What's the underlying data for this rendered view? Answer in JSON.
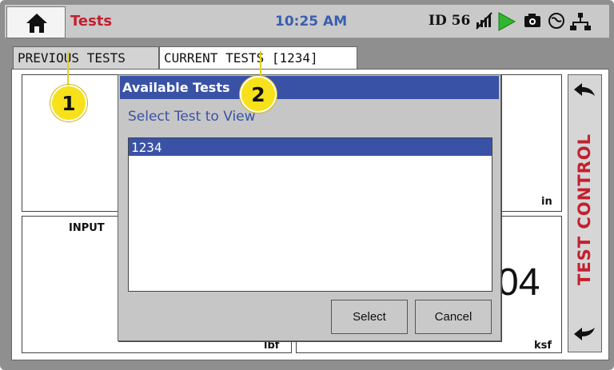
{
  "topbar": {
    "home_icon": "home-icon",
    "title": "Tests",
    "time": "10:25 AM",
    "device_id": "ID 56",
    "status_icons": [
      "no-signal-icon",
      "play-icon",
      "camera-icon",
      "globe-icon",
      "network-icon"
    ]
  },
  "tabs": [
    {
      "label": "PREVIOUS TESTS"
    },
    {
      "label": "CURRENT TESTS [1234]"
    }
  ],
  "panels": {
    "top_right_unit": "in",
    "input_label": "INPUT",
    "bottom_left_unit": "lbf",
    "big_value_partial": "04",
    "bottom_right_unit": "ksf"
  },
  "test_control": {
    "label": "TEST CONTROL",
    "icons": [
      "back-arrow-icon",
      "forward-arrow-icon"
    ]
  },
  "dialog": {
    "title": "Available Tests",
    "prompt": "Select Test to View",
    "items": [
      "1234"
    ],
    "select_label": "Select",
    "cancel_label": "Cancel"
  },
  "callouts": [
    "1",
    "2"
  ],
  "colors": {
    "accent_red": "#c3202f",
    "dialog_blue": "#3952a6",
    "callout_yellow": "#f7e11a"
  }
}
